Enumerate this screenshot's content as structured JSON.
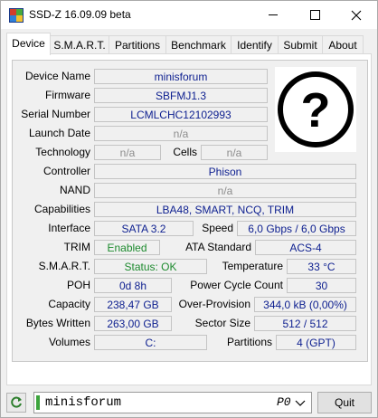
{
  "window": {
    "title": "SSD-Z 16.09.09 beta"
  },
  "tabs": [
    {
      "label": "Device",
      "active": true
    },
    {
      "label": "S.M.A.R.T."
    },
    {
      "label": "Partitions"
    },
    {
      "label": "Benchmark"
    },
    {
      "label": "Identify"
    },
    {
      "label": "Submit"
    },
    {
      "label": "About"
    }
  ],
  "device": {
    "device_name": {
      "label": "Device Name",
      "value": "minisforum"
    },
    "firmware": {
      "label": "Firmware",
      "value": "SBFMJ1.3"
    },
    "serial_number": {
      "label": "Serial Number",
      "value": "LCMLCHC12102993"
    },
    "launch_date": {
      "label": "Launch Date",
      "value": "n/a"
    },
    "technology": {
      "label": "Technology",
      "value": "n/a"
    },
    "cells": {
      "label": "Cells",
      "value": "n/a"
    },
    "controller": {
      "label": "Controller",
      "value": "Phison"
    },
    "nand": {
      "label": "NAND",
      "value": "n/a"
    },
    "capabilities": {
      "label": "Capabilities",
      "value": "LBA48, SMART, NCQ, TRIM"
    },
    "interface": {
      "label": "Interface",
      "value": "SATA 3.2"
    },
    "speed": {
      "label": "Speed",
      "value": "6,0 Gbps / 6,0 Gbps"
    },
    "trim": {
      "label": "TRIM",
      "value": "Enabled"
    },
    "ata_standard": {
      "label": "ATA Standard",
      "value": "ACS-4"
    },
    "smart": {
      "label": "S.M.A.R.T.",
      "value": "Status: OK"
    },
    "temperature": {
      "label": "Temperature",
      "value": "33 °C"
    },
    "poh": {
      "label": "POH",
      "value": "0d 8h"
    },
    "power_cycle_count": {
      "label": "Power Cycle Count",
      "value": "30"
    },
    "capacity": {
      "label": "Capacity",
      "value": "238,47 GB"
    },
    "over_provision": {
      "label": "Over-Provision",
      "value": "344,0 kB (0,00%)"
    },
    "bytes_written": {
      "label": "Bytes Written",
      "value": "263,00 GB"
    },
    "sector_size": {
      "label": "Sector Size",
      "value": "512 / 512"
    },
    "volumes": {
      "label": "Volumes",
      "value": "C:"
    },
    "partitions": {
      "label": "Partitions",
      "value": "4 (GPT)"
    }
  },
  "footer": {
    "drive_selector": {
      "value": "minisforum",
      "port": "P0"
    },
    "quit_label": "Quit"
  },
  "colors": {
    "value_text": "#0c1e8f",
    "na_text": "#8c8c8c",
    "ok_text": "#1d8a2e",
    "drive_indicator": "#3da43d"
  },
  "icons": {
    "unknown_drive": "question-mark-icon",
    "refresh": "refresh-icon"
  }
}
